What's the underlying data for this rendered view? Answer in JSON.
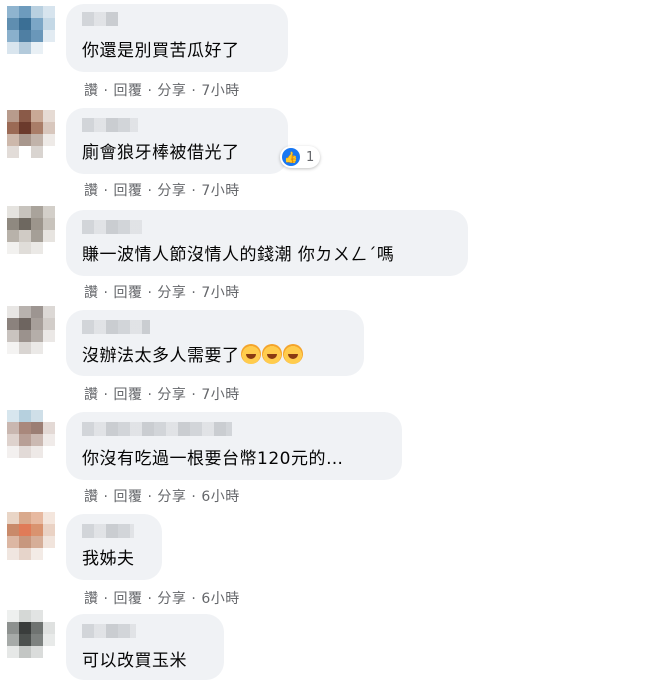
{
  "actions": {
    "like": "讚",
    "reply": "回覆",
    "share": "分享",
    "sep": "·"
  },
  "comments": [
    {
      "text": "你還是別買苦瓜好了",
      "time": "7小時"
    },
    {
      "text": "廁會狼牙棒被借光了",
      "time": "7小時",
      "reaction_count": "1"
    },
    {
      "text": "賺一波情人節沒情人的錢潮 你ㄉㄨㄥˊ嗎",
      "time": "7小時"
    },
    {
      "text": "沒辦法太多人需要了",
      "time": "7小時",
      "emoji_icons": [
        "rolling-laughing-icon",
        "rolling-laughing-icon",
        "rolling-laughing-icon"
      ]
    },
    {
      "text": "你沒有吃過一根要台幣120元的…",
      "time": "6小時"
    },
    {
      "text": "我姊夫",
      "time": "6小時"
    },
    {
      "text": "可以改買玉米"
    }
  ]
}
